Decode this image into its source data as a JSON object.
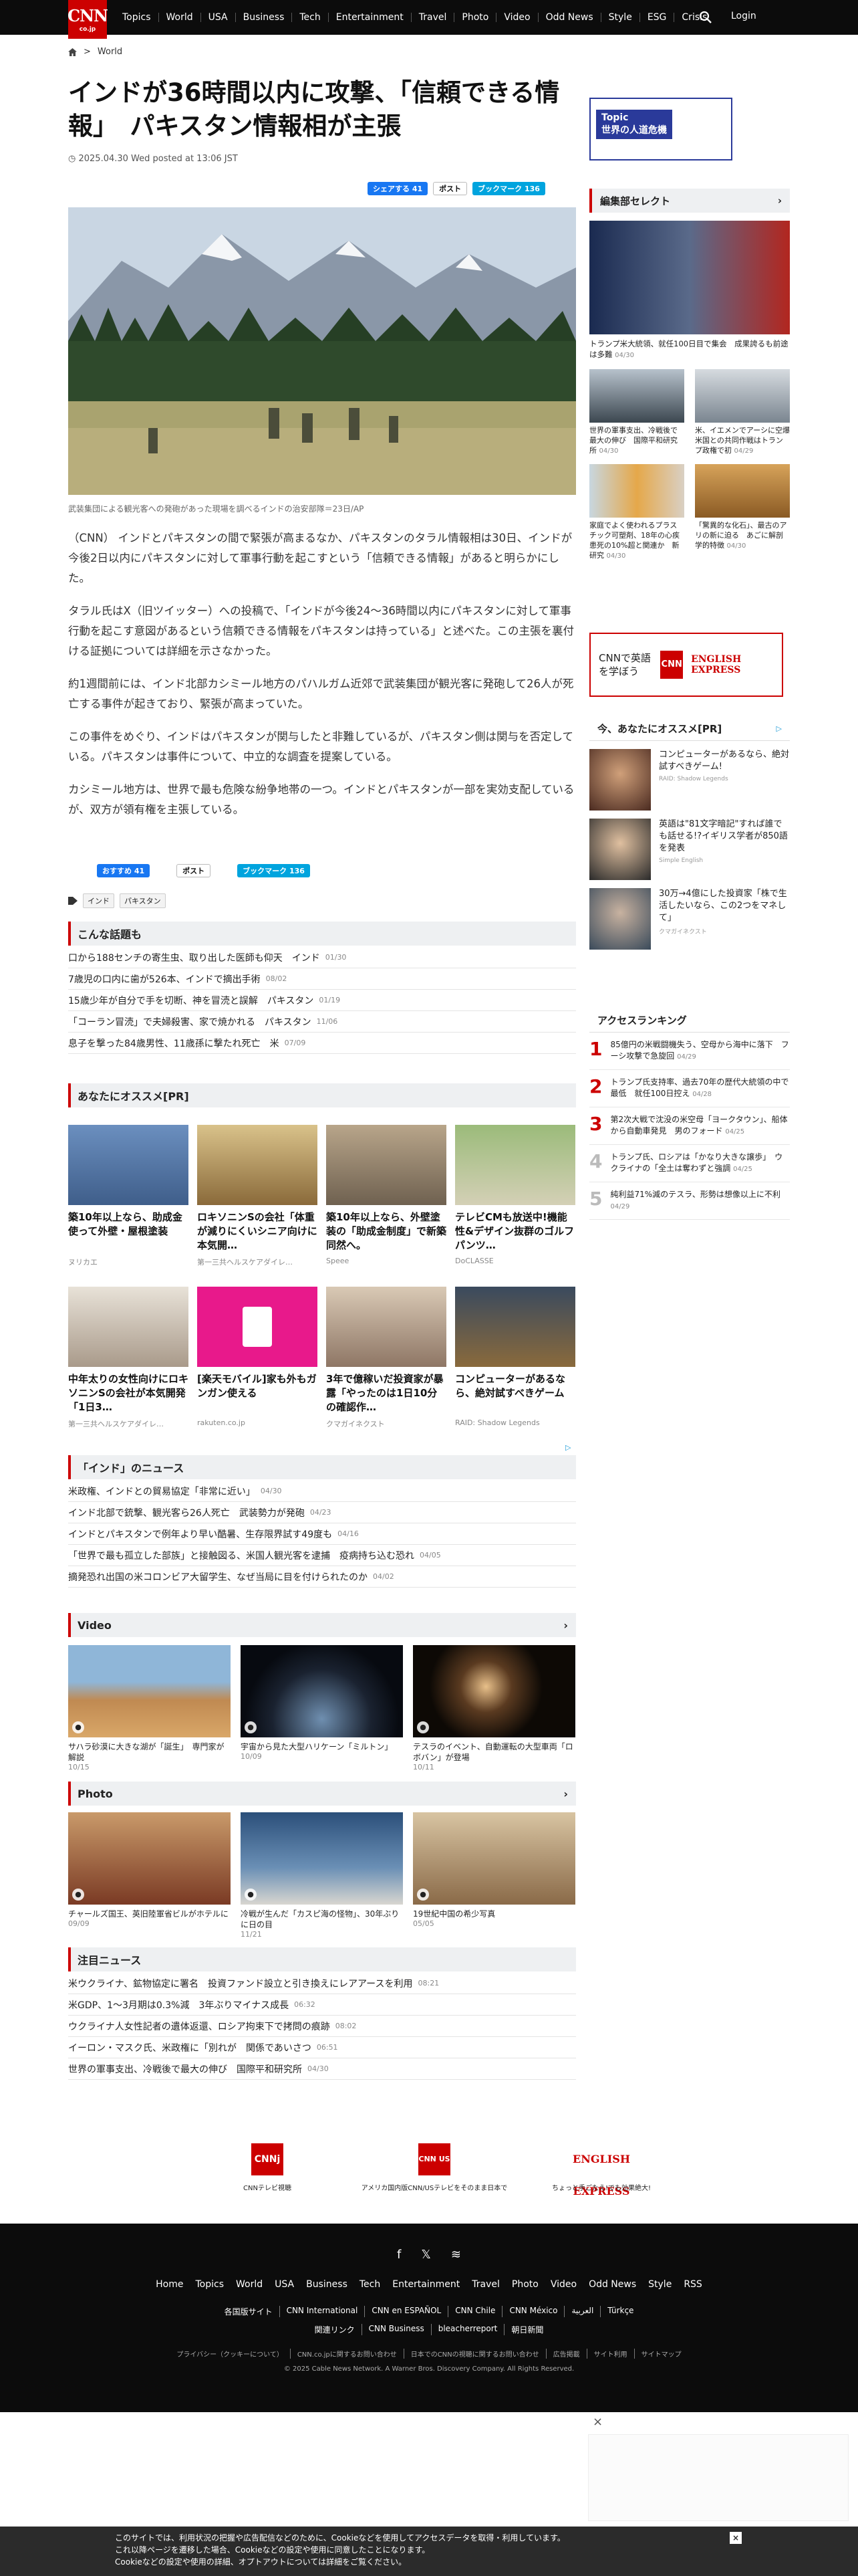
{
  "header": {
    "logo_text": "CNN",
    "logo_sub": "co.jp",
    "nav": [
      "Topics",
      "World",
      "USA",
      "Business",
      "Tech",
      "Entertainment",
      "Travel",
      "Photo",
      "Video",
      "Odd News",
      "Style",
      "ESG",
      "Crisis"
    ],
    "login": "Login"
  },
  "breadcrumb": {
    "section": "World"
  },
  "article": {
    "title": "インドが36時間以内に攻撃、「信頼できる情報」　パキスタン情報相が主張",
    "date": "2025.04.30 Wed posted at 13:06 JST",
    "share_fb": "シェアする 41",
    "share_x": "ポスト",
    "share_hb": "ブックマーク 136",
    "caption": "武装集団による観光客への発砲があった現場を調べるインドの治安部隊＝23日/AP",
    "paragraphs": [
      "（CNN） インドとパキスタンの間で緊張が高まるなか、パキスタンのタラル情報相は30日、インドが今後2日以内にパキスタンに対して軍事行動を起こすという「信頼できる情報」があると明らかにした。",
      "タラル氏はX（旧ツイッター）への投稿で、「インドが今後24～36時間以内にパキスタンに対して軍事行動を起こす意図があるという信頼できる情報をパキスタンは持っている」と述べた。この主張を裏付ける証拠については詳細を示さなかった。",
      "約1週間前には、インド北部カシミール地方のパハルガム近郊で武装集団が観光客に発砲して26人が死亡する事件が起きており、緊張が高まっていた。",
      "この事件をめぐり、インドはパキスタンが関与したと非難しているが、パキスタン側は関与を否定している。パキスタンは事件について、中立的な調査を提案している。",
      "カシミール地方は、世界で最も危険な紛争地帯の一つ。インドとパキスタンが一部を実効支配しているが、双方が領有権を主張している。"
    ],
    "share2_fb": "おすすめ 41",
    "share2_x": "ポスト",
    "share2_hb": "ブックマーク 136",
    "tags": [
      "インド",
      "パキスタン"
    ]
  },
  "topics": {
    "title": "こんな話題も",
    "items": [
      {
        "t": "口から188センチの寄生虫、取り出した医師も仰天　インド",
        "d": "01/30"
      },
      {
        "t": "7歳児の口内に歯が526本、インドで摘出手術",
        "d": "08/02"
      },
      {
        "t": "15歳少年が自分で手を切断、神を冒涜と誤解　パキスタン",
        "d": "01/19"
      },
      {
        "t": "「コーラン冒涜」で夫婦殺害、家で焼かれる　パキスタン",
        "d": "11/06"
      },
      {
        "t": "息子を撃った84歳男性、11歳孫に撃たれ死亡　米",
        "d": "07/09"
      }
    ]
  },
  "recommend": {
    "title": "あなたにオススメ[PR]",
    "items": [
      {
        "t": "築10年以上なら、助成金使って外壁・屋根塗装",
        "s": "ヌリカエ"
      },
      {
        "t": "ロキソニンSの会社「体重が減りにくいシニア向けに本気開…",
        "s": "第一三共ヘルスケアダイレ…"
      },
      {
        "t": "築10年以上なら、外壁塗装の「助成金制度」で新築同然へ。",
        "s": "Speee"
      },
      {
        "t": "テレビCMも放送中!機能性&デザイン抜群のゴルフパンツ…",
        "s": "DoCLASSE"
      },
      {
        "t": "中年太りの女性向けにロキソニンSの会社が本気開発「1日3…",
        "s": "第一三共ヘルスケアダイレ…"
      },
      {
        "t": "[楽天モバイル]家も外もガンガン使える",
        "s": "rakuten.co.jp"
      },
      {
        "t": "3年で億稼いだ投資家が暴露「やったのは1日10分の確認作…",
        "s": "クマガイネクスト"
      },
      {
        "t": "コンピューターがあるなら、絶対試すべきゲーム",
        "s": "RAID: Shadow Legends"
      }
    ]
  },
  "india_news": {
    "title": "「インド」のニュース",
    "items": [
      {
        "t": "米政権、インドとの貿易協定「非常に近い」",
        "d": "04/30"
      },
      {
        "t": "インド北部で銃撃、観光客ら26人死亡　武装勢力が発砲",
        "d": "04/23"
      },
      {
        "t": "インドとパキスタンで例年より早い酷暑、生存限界試す49度も",
        "d": "04/16"
      },
      {
        "t": "「世界で最も孤立した部族」と接触図る、米国人観光客を逮捕　疫病持ち込む恐れ",
        "d": "04/05"
      },
      {
        "t": "摘発恐れ出国の米コロンビア大留学生、なぜ当局に目を付けられたのか",
        "d": "04/02"
      }
    ]
  },
  "video": {
    "title": "Video",
    "items": [
      {
        "t": "サハラ砂漠に大きな湖が「誕生」　専門家が解説",
        "d": "10/15"
      },
      {
        "t": "宇宙から見た大型ハリケーン「ミルトン」",
        "d": "10/09"
      },
      {
        "t": "テスラのイベント、自動運転の大型車両「ロボバン」が登場",
        "d": "10/11"
      }
    ]
  },
  "photo": {
    "title": "Photo",
    "items": [
      {
        "t": "チャールズ国王、英旧陸軍省ビルがホテルに",
        "d": "09/09"
      },
      {
        "t": "冷戦が生んだ「カスピ海の怪物」、30年ぶりに日の目",
        "d": "11/21"
      },
      {
        "t": "19世紀中国の希少写真",
        "d": "05/05"
      }
    ]
  },
  "featured": {
    "title": "注目ニュース",
    "items": [
      {
        "t": "米ウクライナ、鉱物協定に署名　投資ファンド設立と引き換えにレアアースを利用",
        "d": "08:21"
      },
      {
        "t": "米GDP、1～3月期は0.3%減　3年ぶりマイナス成長",
        "d": "06:32"
      },
      {
        "t": "ウクライナ人女性記者の遺体返還、ロシア拘束下で拷問の痕跡",
        "d": "08:02"
      },
      {
        "t": "イーロン・マスク氏、米政権に「別れが　関係であいさつ",
        "d": "06:51"
      },
      {
        "t": "世界の軍事支出、冷戦後で最大の伸び　国際平和研究所",
        "d": "04/30"
      }
    ]
  },
  "sidebar": {
    "topic_label": "Topic",
    "topic_text": "世界の人道危機",
    "editor_title": "編集部セレクト",
    "editor_items": [
      {
        "t": "トランプ米大統領、就任100日目で集会　成果誇るも前途は多難",
        "d": "04/30"
      },
      {
        "t": "世界の軍事支出、冷戦後で最大の伸び　国際平和研究所",
        "d": "04/30"
      },
      {
        "t": "米、イエメンでアーシに空爆　米国との共同作戦はトランプ政権で初",
        "d": "04/29"
      },
      {
        "t": "家庭でよく使われるプラスチック可塑剤、18年の心疾患死の10%超と関連か　新研究",
        "d": "04/30"
      },
      {
        "t": "「驚異的な化石」、最古のアリの新に迫る　あごに解剖学的特徴",
        "d": "04/30"
      }
    ],
    "eng_ad_text": "CNNで英語を学ぼう",
    "eng_ad_logo": "ENGLISH EXPRESS",
    "pr_title": "今、あなたにオススメ[PR]",
    "pr_items": [
      {
        "t": "コンピューターがあるなら、絶対試すべきゲーム!",
        "s": "RAID: Shadow Legends"
      },
      {
        "t": "英語は\"81文字暗記\"すれば誰でも話せる!?イギリス学者が850語を発表",
        "s": "Simple English"
      },
      {
        "t": "30万→4億にした投資家「株で生活したいなら、この2つをマネして」",
        "s": "クマガイネクスト"
      }
    ],
    "ranking_title": "アクセスランキング",
    "ranking": [
      {
        "n": "1",
        "t": "85億円の米戦闘機失う、空母から海中に落下　フーシ攻撃で急旋回",
        "d": "04/29"
      },
      {
        "n": "2",
        "t": "トランプ氏支持率、過去70年の歴代大統領の中で最低　就任100日控え",
        "d": "04/28"
      },
      {
        "n": "3",
        "t": "第2次大戦で沈没の米空母「ヨークタウン」、船体から自動車発見　男のフォード",
        "d": "04/25"
      },
      {
        "n": "4",
        "t": "トランプ氏、ロシアは「かなり大きな譲歩」　ウクライナの「全土は奪わずと強調",
        "d": "04/25"
      },
      {
        "n": "5",
        "t": "純利益71%減のテスラ、形勢は想像以上に不利",
        "d": "04/29"
      }
    ]
  },
  "bottom_ads": [
    {
      "logo": "CNNj",
      "t": "CNNテレビ視聴"
    },
    {
      "logo": "CNN US",
      "t": "アメリカ国内版CNN/USテレビをそのまま日本で"
    },
    {
      "logo": "ENGLISH EXPRESS",
      "t": "ちょっと手ごたえ!でも効果絶大!"
    }
  ],
  "footer": {
    "nav": [
      "Home",
      "Topics",
      "World",
      "USA",
      "Business",
      "Tech",
      "Entertainment",
      "Travel",
      "Photo",
      "Video",
      "Odd News",
      "Style",
      "RSS"
    ],
    "links1": [
      "各国版サイト",
      "CNN International",
      "CNN en ESPAÑOL",
      "CNN Chile",
      "CNN México",
      "العربية",
      "Türkçe"
    ],
    "links2": [
      "関連リンク",
      "CNN Business",
      "bleacherreport",
      "朝日新聞"
    ],
    "legal": [
      "プライバシー（クッキーについて）",
      "CNN.co.jpに関するお問い合わせ",
      "日本でのCNNの視聴に関するお問い合わせ",
      "広告掲載",
      "サイト利用",
      "サイトマップ"
    ],
    "copyright": "© 2025 Cable News Network. A Warner Bros. Discovery Company. All Rights Reserved."
  },
  "cookie": {
    "lines": [
      "このサイトでは、利用状況の把握や広告配信などのために、Cookieなどを使用してアクセスデータを取得・利用しています。",
      "これ以降ページを遷移した場合、Cookieなどの設定や使用に同意したことになります。",
      "Cookieなどの設定や使用の詳細、オプトアウトについては詳細をご覧ください。"
    ]
  },
  "colors": {
    "brand": "#cc0000",
    "header": "#0c0c0c"
  }
}
